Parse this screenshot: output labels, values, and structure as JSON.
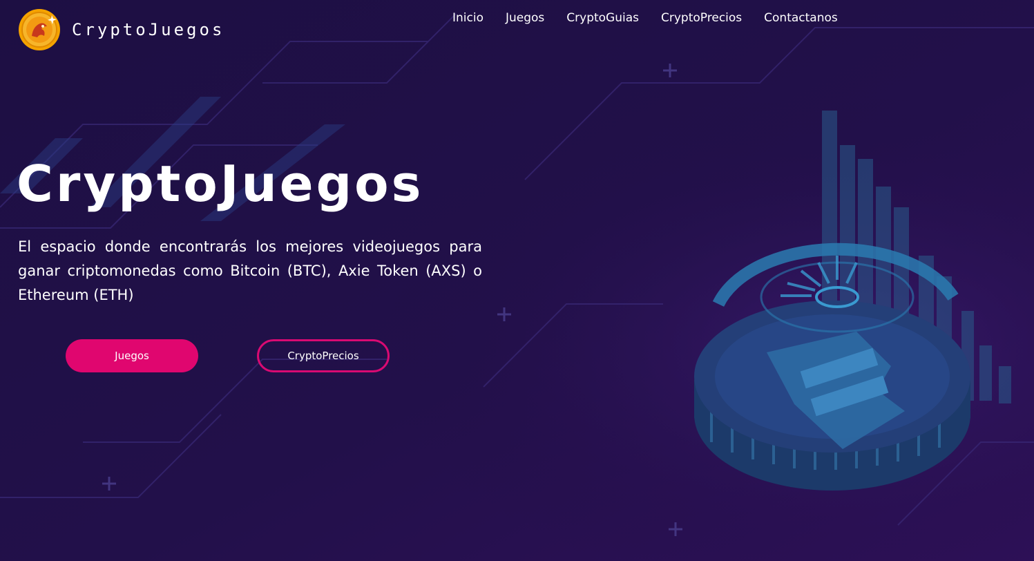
{
  "brand": {
    "name": "CryptoJuegos",
    "logo_icon": "dragon-coin-icon"
  },
  "nav": {
    "items": [
      {
        "label": "Inicio"
      },
      {
        "label": "Juegos"
      },
      {
        "label": "CryptoGuias"
      },
      {
        "label": "CryptoPrecios"
      },
      {
        "label": "Contactanos"
      }
    ]
  },
  "hero": {
    "title": "CryptoJuegos",
    "subtitle": "El espacio donde encontrarás los mejores videojuegos para ganar criptomonedas como Bitcoin (BTC), Axie Token (AXS) o Ethereum (ETH)",
    "primary_button": "Juegos",
    "secondary_button": "CryptoPrecios",
    "illustration_icon": "bitcoin-coin-icon"
  },
  "colors": {
    "background": "#1f0d42",
    "accent": "#e0066f",
    "illustration": "#2a7bb0"
  }
}
